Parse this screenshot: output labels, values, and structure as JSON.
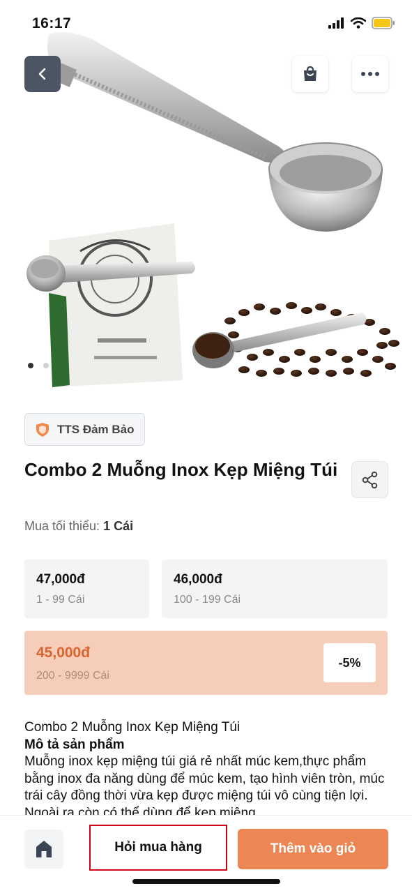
{
  "status_bar": {
    "time": "16:17"
  },
  "hero": {
    "image": "coffee-scoop-clip-photo",
    "slide_count": 2,
    "active_slide": 1
  },
  "nav": {
    "back_icon": "chevron-left-icon",
    "cart_icon": "shopping-bag-icon",
    "more_icon": "more-dots-icon"
  },
  "badge": {
    "label": "TTS Đảm Bảo",
    "icon": "shield-icon"
  },
  "product": {
    "title": "Combo 2 Muỗng Inox Kẹp Miệng Túi",
    "min_order_label": "Mua tối thiểu: ",
    "min_order_value": "1 Cái"
  },
  "price_tiers": [
    {
      "price": "47,000đ",
      "range": "1 - 99 Cái"
    },
    {
      "price": "46,000đ",
      "range": "100 - 199 Cái"
    },
    {
      "price": "45,000đ",
      "range": "200 - 9999 Cái",
      "discount": "-5%"
    }
  ],
  "description": {
    "line1": "Combo 2 Muỗng Inox Kẹp Miệng Túi",
    "heading": "Mô tả sản phẩm",
    "body": "Muỗng inox kẹp miệng túi giá rẻ nhất múc kem,thực phẩm bằng inox đa năng dùng để múc kem, tạo hình viên tròn, múc trái cây đồng thời vừa kẹp được miệng túi vô cùng tiện lợi. Ngoài ra còn có thể dùng để kẹp miệng"
  },
  "bottom_bar": {
    "home_icon": "home-icon",
    "ask_label": "Hỏi mua hàng",
    "add_label": "Thêm vào giỏ"
  },
  "colors": {
    "accent": "#ec8655",
    "highlight_tier": "#f6cdb9",
    "highlight_price": "#d9642f",
    "box_outline": "#d0021b"
  }
}
